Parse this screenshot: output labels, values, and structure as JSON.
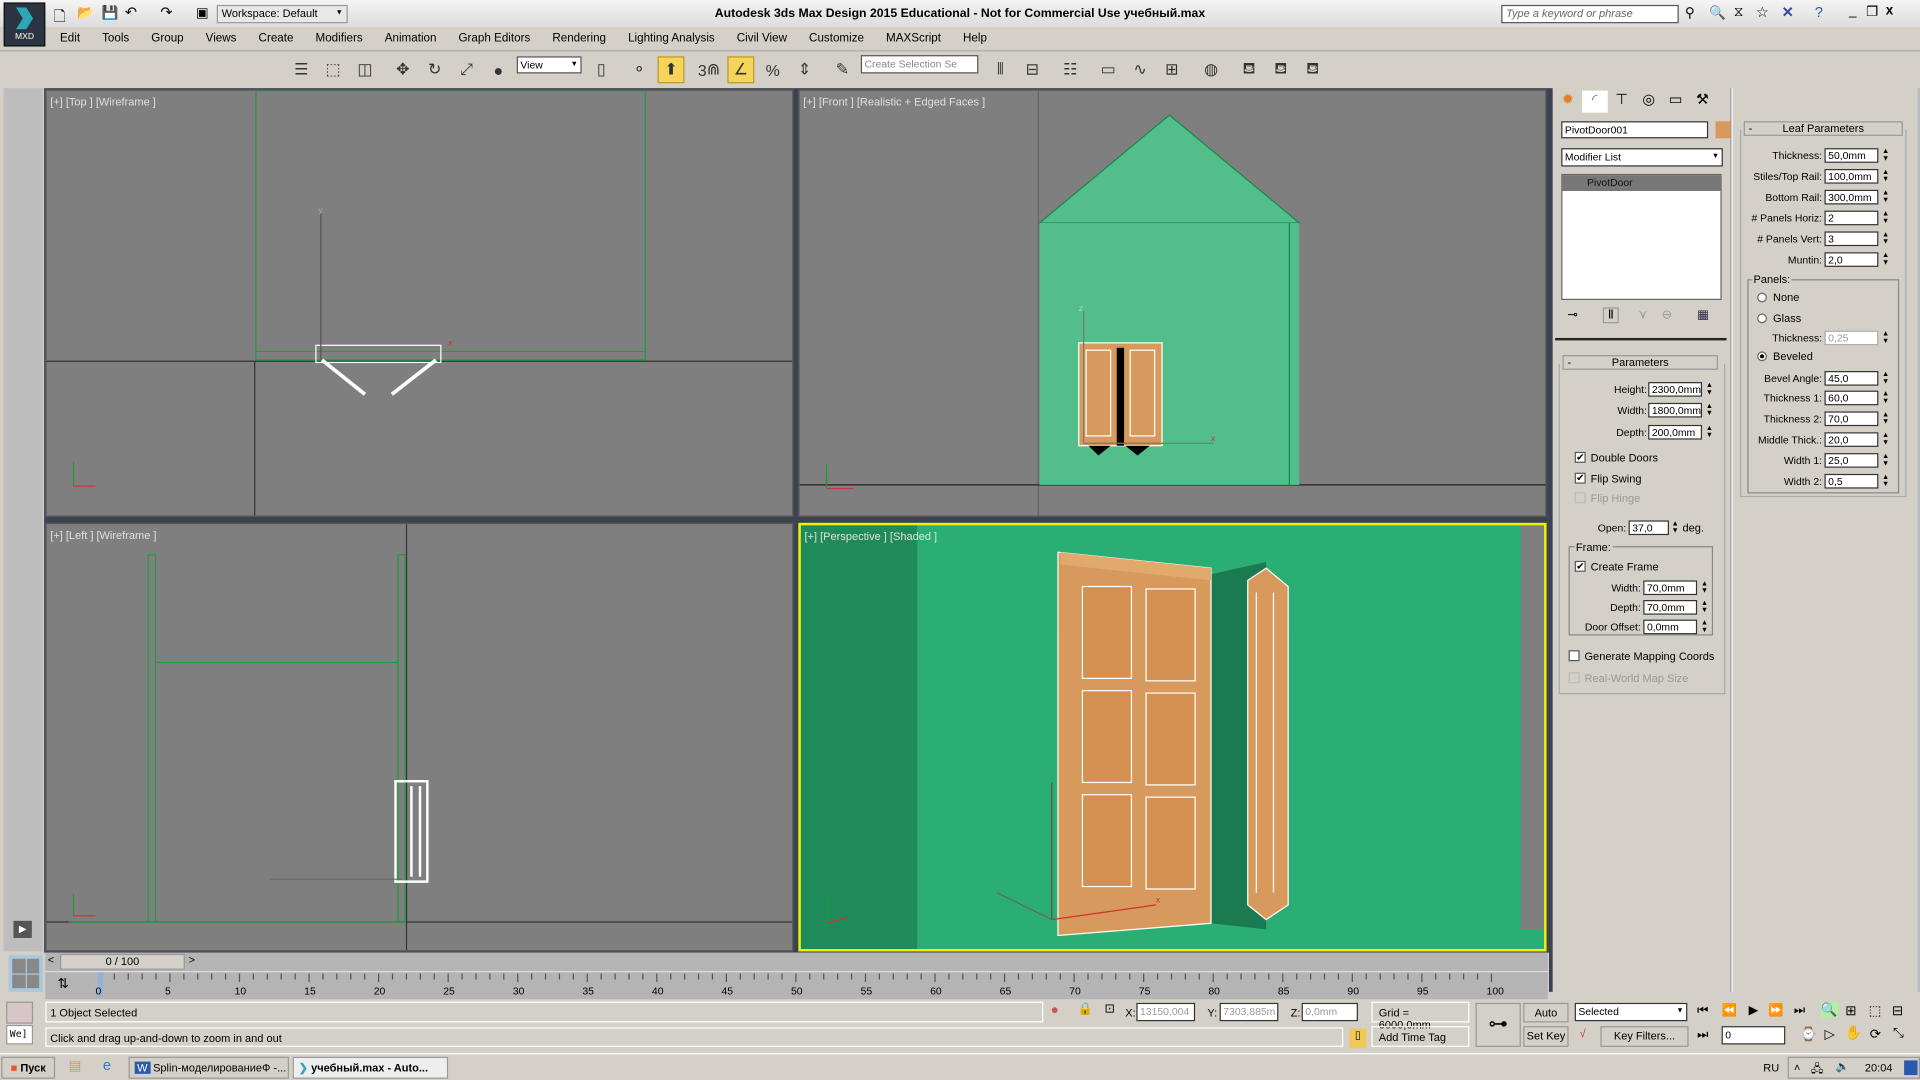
{
  "window": {
    "title": "Autodesk 3ds Max Design 2015  Educational - Not for Commercial Use    учебный.max",
    "app_badge": "MXD",
    "workspace": "Workspace: Default",
    "search_placeholder": "Type a keyword or phrase"
  },
  "menu": [
    "Edit",
    "Tools",
    "Group",
    "Views",
    "Create",
    "Modifiers",
    "Animation",
    "Graph Editors",
    "Rendering",
    "Lighting Analysis",
    "Civil View",
    "Customize",
    "MAXScript",
    "Help"
  ],
  "toolbar": {
    "ref_coord": "View",
    "selection_set_placeholder": "Create Selection Se",
    "snap_label": "3"
  },
  "viewports": [
    {
      "label": "[+] [Top ] [Wireframe ]"
    },
    {
      "label": "[+] [Front ] [Realistic + Edged Faces ]"
    },
    {
      "label": "[+] [Left ] [Wireframe ]"
    },
    {
      "label": "[+] [Perspective ] [Shaded ]"
    }
  ],
  "colors": {
    "wall": "#52bf8a",
    "persp_wall": "#2aae74",
    "door": "#d89a5c",
    "active_border": "#f5f000",
    "viewport_bg": "#7f7f7f"
  },
  "command_panel": {
    "tabs": [
      "create",
      "modify",
      "hierarchy",
      "motion",
      "display",
      "utilities"
    ],
    "object_name": "PivotDoor001",
    "object_color": "#d89a5c",
    "modifier_list": "Modifier List",
    "stack": [
      "PivotDoor"
    ],
    "parameters": {
      "title": "Parameters",
      "height_label": "Height:",
      "height": "2300,0mm",
      "width_label": "Width:",
      "width": "1800,0mm",
      "depth_label": "Depth:",
      "depth": "200,0mm",
      "double_doors": "Double Doors",
      "double_doors_checked": true,
      "flip_swing": "Flip Swing",
      "flip_swing_checked": true,
      "flip_hinge": "Flip Hinge",
      "flip_hinge_checked": false,
      "open_label": "Open:",
      "open": "37,0",
      "open_unit": "deg.",
      "frame_label": "Frame:",
      "create_frame": "Create Frame",
      "create_frame_checked": true,
      "frame_width_label": "Width:",
      "frame_width": "70,0mm",
      "frame_depth_label": "Depth:",
      "frame_depth": "70,0mm",
      "door_offset_label": "Door Offset:",
      "door_offset": "0,0mm",
      "gen_mapping": "Generate Mapping Coords",
      "gen_mapping_checked": false,
      "real_world": "Real-World Map Size",
      "real_world_checked": false
    },
    "leaf": {
      "title": "Leaf Parameters",
      "thickness_label": "Thickness:",
      "thickness": "50,0mm",
      "stiles_label": "Stiles/Top Rail:",
      "stiles": "100,0mm",
      "bottom_label": "Bottom Rail:",
      "bottom": "300,0mm",
      "ph_label": "# Panels Horiz:",
      "ph": "2",
      "pv_label": "# Panels Vert:",
      "pv": "3",
      "muntin_label": "Muntin:",
      "muntin": "2,0",
      "panels_label": "Panels:",
      "none": "None",
      "glass": "Glass",
      "glass_thick_label": "Thickness:",
      "glass_thick": "0,25",
      "beveled": "Beveled",
      "selected_panel": "Beveled",
      "bevel_angle_label": "Bevel Angle:",
      "bevel_angle": "45,0",
      "t1_label": "Thickness 1:",
      "t1": "60,0",
      "t2_label": "Thickness 2:",
      "t2": "70,0",
      "mid_label": "Middle Thick.:",
      "mid": "20,0",
      "w1_label": "Width 1:",
      "w1": "25,0",
      "w2_label": "Width 2:",
      "w2": "0,5"
    }
  },
  "timeline": {
    "frame": "0 / 100",
    "ticks": [
      "0",
      "5",
      "10",
      "15",
      "20",
      "25",
      "30",
      "35",
      "40",
      "45",
      "50",
      "55",
      "60",
      "65",
      "70",
      "75",
      "80",
      "85",
      "90",
      "95",
      "100"
    ]
  },
  "status": {
    "selection": "1 Object Selected",
    "prompt": "Click and drag up-and-down to zoom in and out",
    "maxscript": "We]",
    "x_label": "X:",
    "x": "13150,004",
    "y_label": "Y:",
    "y": "7303,885m",
    "z_label": "Z:",
    "z": "0,0mm",
    "grid": "Grid = 6000,0mm",
    "add_time_tag": "Add Time Tag",
    "auto_key": "Auto Key",
    "set_key": "Set Key",
    "key_mode": "Selected",
    "key_filters": "Key Filters...",
    "current_frame": "0"
  },
  "taskbar": {
    "start": "Пуск",
    "items": [
      "Splin-моделированиеФ -...",
      "учебный.max - Auto..."
    ],
    "lang": "RU",
    "clock": "20:04"
  }
}
